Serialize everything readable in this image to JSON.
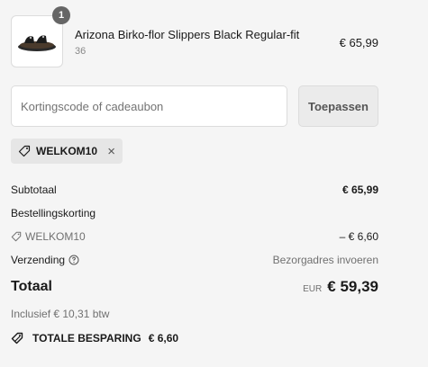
{
  "product": {
    "quantity": "1",
    "name": "Arizona Birko-flor Slippers Black Regular-fit",
    "variant": "36",
    "price": "€ 65,99"
  },
  "discount": {
    "placeholder": "Kortingscode of cadeaubon",
    "apply_label": "Toepassen",
    "applied_code": "WELKOM10"
  },
  "summary": {
    "subtotal_label": "Subtotaal",
    "subtotal_value": "€ 65,99",
    "order_discount_label": "Bestellingskorting",
    "discount_code": "WELKOM10",
    "discount_value": "– € 6,60",
    "shipping_label": "Verzending",
    "shipping_value": "Bezorgadres invoeren",
    "total_label": "Totaal",
    "total_currency": "EUR",
    "total_value": "€ 59,39",
    "tax_note": "Inclusief € 10,31 btw",
    "savings_label": "TOTALE BESPARING",
    "savings_value": "€ 6,60"
  }
}
